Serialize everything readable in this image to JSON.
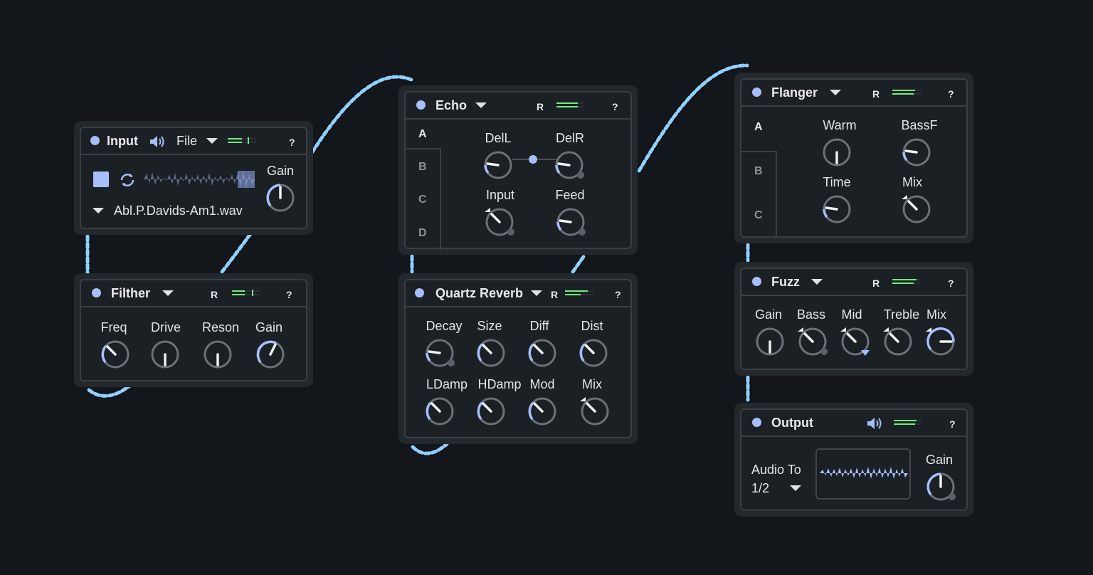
{
  "devices": {
    "input": {
      "title": "Input",
      "source": "File",
      "help": "?",
      "file_name": "Abl.P.Davids-Am1.wav",
      "gain_label": "Gain",
      "speaker_icon": "speaker-icon",
      "stop_icon": "stop-icon",
      "loop_icon": "loop-icon"
    },
    "filther": {
      "title": "Filther",
      "r_label": "R",
      "help": "?",
      "knobs": [
        "Freq",
        "Drive",
        "Reson",
        "Gain"
      ]
    },
    "echo": {
      "title": "Echo",
      "r_label": "R",
      "help": "?",
      "tabs": [
        "A",
        "B",
        "C",
        "D"
      ],
      "knobs": [
        "DelL",
        "DelR",
        "Input",
        "Feed"
      ]
    },
    "reverb": {
      "title": "Quartz Reverb",
      "r_label": "R",
      "help": "?",
      "knobs_row1": [
        "Decay",
        "Size",
        "Diff",
        "Dist"
      ],
      "knobs_row2": [
        "LDamp",
        "HDamp",
        "Mod",
        "Mix"
      ]
    },
    "flanger": {
      "title": "Flanger",
      "r_label": "R",
      "help": "?",
      "tabs": [
        "A",
        "B",
        "C"
      ],
      "knobs": [
        "Warm",
        "BassF",
        "Time",
        "Mix"
      ]
    },
    "fuzz": {
      "title": "Fuzz",
      "r_label": "R",
      "help": "?",
      "knobs": [
        "Gain",
        "Bass",
        "Mid",
        "Treble",
        "Mix"
      ]
    },
    "output": {
      "title": "Output",
      "help": "?",
      "audio_to_label": "Audio To",
      "audio_to_value": "1/2",
      "gain_label": "Gain"
    }
  },
  "colors": {
    "background": "#13171b",
    "panel": "#1b2025",
    "accent": "#a8befa",
    "meter": "#6ef07c",
    "cable": "#8fd0ff"
  }
}
